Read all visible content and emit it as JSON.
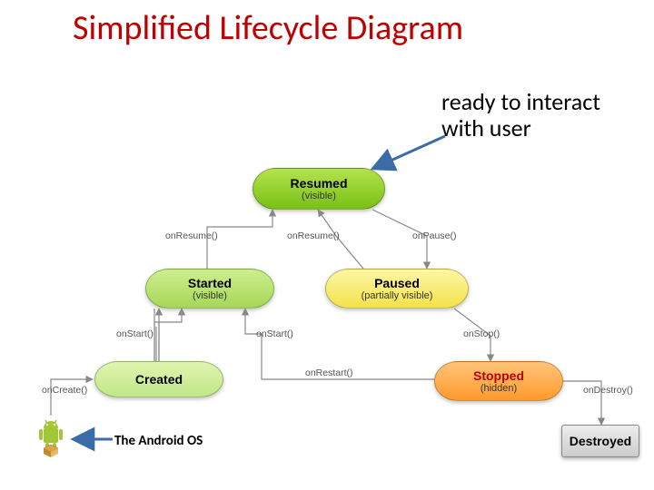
{
  "title": "Simplified Lifecycle Diagram",
  "annotations": {
    "resumed": "ready to interact\nwith user",
    "android": "The Android OS"
  },
  "nodes": {
    "resumed": {
      "label": "Resumed",
      "sub": "(visible)"
    },
    "started": {
      "label": "Started",
      "sub": "(visible)"
    },
    "paused": {
      "label": "Paused",
      "sub": "(partially visible)"
    },
    "created": {
      "label": "Created",
      "sub": ""
    },
    "stopped": {
      "label": "Stopped",
      "sub": "(hidden)"
    },
    "destroyed": {
      "label": "Destroyed",
      "sub": ""
    }
  },
  "edges": {
    "onCreate": "onCreate()",
    "onStart1": "onStart()",
    "onStart2": "onStart()",
    "onResume1": "onResume()",
    "onResume2": "onResume()",
    "onPause": "onPause()",
    "onStop": "onStop()",
    "onRestart": "onRestart()",
    "onDestroy": "onDestroy()"
  },
  "colors": {
    "titleColor": "#c00000",
    "arrowBlue": "#3b6ca8",
    "edgeGray": "#888"
  },
  "chart_data": {
    "type": "state-diagram",
    "title": "Simplified Lifecycle Diagram",
    "states": [
      {
        "id": "created",
        "label": "Created",
        "sub": "",
        "tier": 4
      },
      {
        "id": "started",
        "label": "Started",
        "sub": "(visible)",
        "tier": 3
      },
      {
        "id": "resumed",
        "label": "Resumed",
        "sub": "(visible)",
        "tier": 1
      },
      {
        "id": "paused",
        "label": "Paused",
        "sub": "(partially visible)",
        "tier": 3
      },
      {
        "id": "stopped",
        "label": "Stopped",
        "sub": "(hidden)",
        "tier": 4
      },
      {
        "id": "destroyed",
        "label": "Destroyed",
        "sub": "",
        "tier": 5
      }
    ],
    "transitions": [
      {
        "from": "android-os",
        "to": "created",
        "label": "onCreate()"
      },
      {
        "from": "created",
        "to": "started",
        "label": "onStart()"
      },
      {
        "from": "started",
        "to": "resumed",
        "label": "onResume()"
      },
      {
        "from": "resumed",
        "to": "paused",
        "label": "onPause()"
      },
      {
        "from": "paused",
        "to": "resumed",
        "label": "onResume()"
      },
      {
        "from": "paused",
        "to": "stopped",
        "label": "onStop()"
      },
      {
        "from": "stopped",
        "to": "started",
        "label": "onRestart() → onStart()"
      },
      {
        "from": "stopped",
        "to": "destroyed",
        "label": "onDestroy()"
      }
    ],
    "annotations": [
      {
        "target": "resumed",
        "text": "ready to interact with user"
      },
      {
        "target": "android-os",
        "text": "The Android OS"
      }
    ]
  }
}
